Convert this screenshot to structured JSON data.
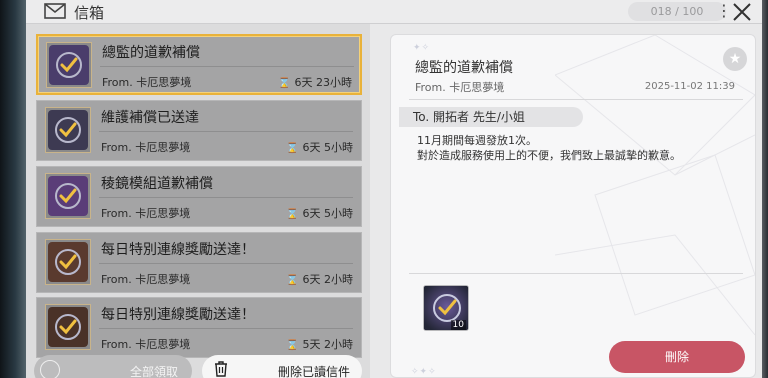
{
  "header": {
    "title": "信箱",
    "counter": "018 / 100",
    "mail_icon": "envelope-icon",
    "menu_icon": "more-vertical-icon",
    "close_icon": "close-icon"
  },
  "mail_list": [
    {
      "subject": "總監的道歉補償",
      "from": "From. 卡厄思夢境",
      "time": "6天 23小時",
      "selected": true,
      "thumb_color": "#4a3d6b"
    },
    {
      "subject": "維護補償已送達",
      "from": "From. 卡厄思夢境",
      "time": "6天 5小時",
      "selected": false,
      "thumb_color": "#3d3a52"
    },
    {
      "subject": "稜鏡模組道歉補償",
      "from": "From. 卡厄思夢境",
      "time": "6天 5小時",
      "selected": false,
      "thumb_color": "#5a3d78"
    },
    {
      "subject": "每日特別連線獎勵送達！",
      "from": "From. 卡厄思夢境",
      "time": "6天 2小時",
      "selected": false,
      "thumb_color": "#5a3a2e"
    },
    {
      "subject": "每日特別連線獎勵送達！",
      "from": "From. 卡厄思夢境",
      "time": "5天 2小時",
      "selected": false,
      "thumb_color": "#4a3228"
    }
  ],
  "actions": {
    "claim_all": "全部領取",
    "delete_read": "刪除已讀信件"
  },
  "detail": {
    "title": "總監的道歉補償",
    "from": "From. 卡厄思夢境",
    "date": "2025-11-02 11:39",
    "to": "To. 開拓者 先生/小姐",
    "body_line1": "11月期間每週發放1次。",
    "body_line2": "對於造成服務使用上的不便，我們致上最誠摯的歉意。",
    "attachment_qty": "10",
    "delete_label": "刪除",
    "star_icon": "star-icon"
  },
  "colors": {
    "selected_border": "#e9b23a",
    "delete_button": "#c85565",
    "check_gold": "#f0c040"
  }
}
